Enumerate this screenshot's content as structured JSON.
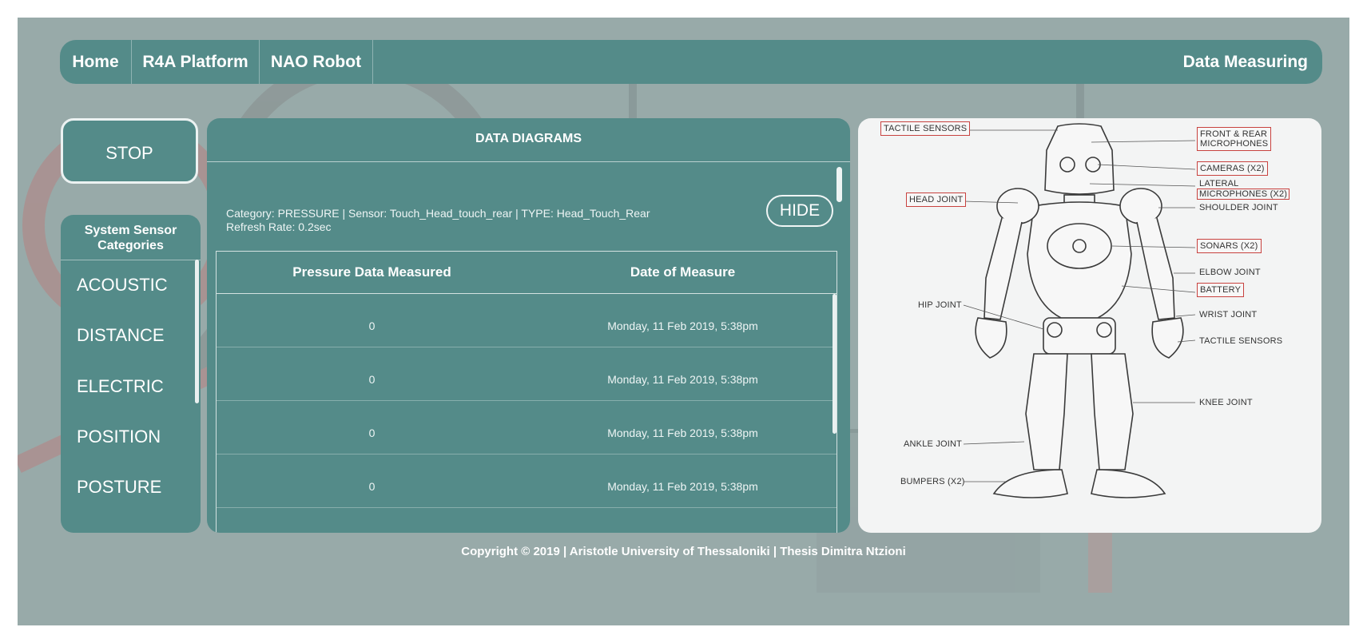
{
  "nav": {
    "items": [
      "Home",
      "R4A Platform",
      "NAO Robot"
    ],
    "page_title": "Data Measuring"
  },
  "stop_label": "STOP",
  "sidebar": {
    "title": "System Sensor Categories",
    "items": [
      "ACOUSTIC",
      "DISTANCE",
      "ELECTRIC",
      "POSITION",
      "POSTURE"
    ]
  },
  "data_panel": {
    "title": "DATA DIAGRAMS",
    "meta_line1": "Category: PRESSURE | Sensor: Touch_Head_touch_rear | TYPE: Head_Touch_Rear",
    "meta_line2": "Refresh Rate: 0.2sec",
    "hide_label": "HIDE",
    "columns": [
      "Pressure Data Measured",
      "Date of Measure"
    ],
    "rows": [
      [
        "0",
        "Monday, 11 Feb 2019, 5:38pm"
      ],
      [
        "0",
        "Monday, 11 Feb 2019, 5:38pm"
      ],
      [
        "0",
        "Monday, 11 Feb 2019, 5:38pm"
      ],
      [
        "0",
        "Monday, 11 Feb 2019, 5:38pm"
      ]
    ]
  },
  "robot_labels": {
    "tactile_sensors_head": "TACTILE SENSORS",
    "front_rear_mic_1": "FRONT & REAR",
    "front_rear_mic_2": "MICROPHONES",
    "cameras": "CAMERAS (X2)",
    "lateral_mic_1": "LATERAL",
    "lateral_mic_2": "MICROPHONES (X2)",
    "head_joint": "HEAD JOINT",
    "shoulder_joint": "SHOULDER JOINT",
    "sonars": "SONARS (X2)",
    "elbow_joint": "ELBOW JOINT",
    "battery": "BATTERY",
    "hip_joint": "HIP JOINT",
    "wrist_joint": "WRIST JOINT",
    "tactile_sensors_hand": "TACTILE SENSORS",
    "knee_joint": "KNEE JOINT",
    "ankle_joint": "ANKLE JOINT",
    "bumpers": "BUMPERS (X2)"
  },
  "footer": "Copyright © 2019 | Aristotle University of Thessaloniki | Thesis Dimitra Ntzioni",
  "colors": {
    "background": "#98aaa9",
    "panel_teal": "#548b89",
    "label_border": "#c8423f",
    "robot_panel": "#f3f4f4"
  }
}
